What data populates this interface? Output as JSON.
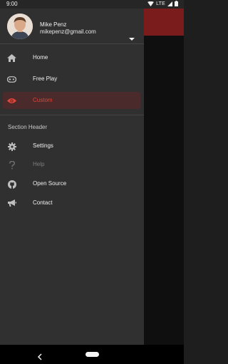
{
  "status_bar": {
    "time": "9:00",
    "network": "LTE"
  },
  "drawer": {
    "account": {
      "name": "Mike Penz",
      "email": "mikepenz@gmail.com"
    },
    "items": [
      {
        "label": "Home",
        "icon": "home-icon"
      },
      {
        "label": "Free Play",
        "icon": "gamepad-icon"
      },
      {
        "label": "Custom",
        "icon": "eye-icon",
        "selected": true
      }
    ],
    "section_header": "Section Header",
    "secondary_items": [
      {
        "label": "Settings",
        "icon": "gear-icon"
      },
      {
        "label": "Help",
        "icon": "question-icon",
        "disabled": true
      },
      {
        "label": "Open Source",
        "icon": "github-icon"
      },
      {
        "label": "Contact",
        "icon": "megaphone-icon"
      }
    ]
  },
  "colors": {
    "accent": "#e0453a",
    "selected_bg": "#4a2a2a",
    "drawer_bg": "#303030",
    "toolbar": "#7a1c1c"
  }
}
